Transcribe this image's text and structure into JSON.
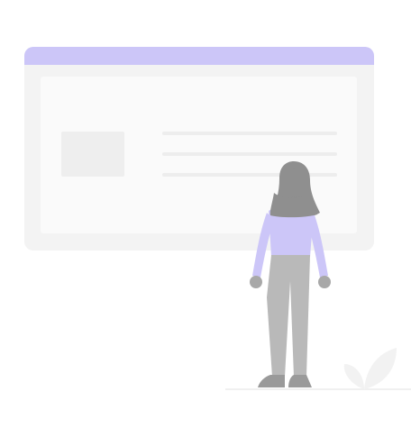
{
  "illustration": {
    "subject": "empty-state",
    "colors": {
      "accent": "#ccc6f8",
      "panel": "#f3f3f3",
      "panel_inner": "#fafafa",
      "placeholder_block": "#eeeeee",
      "placeholder_line": "#ededed",
      "figure_hair": "#8f8f8f",
      "figure_skin": "#a8a8a8",
      "figure_pants": "#b9b9b9",
      "figure_shoes": "#9a9a9a",
      "plant": "#f2f2f2",
      "ground": "#f0f0f0"
    }
  }
}
